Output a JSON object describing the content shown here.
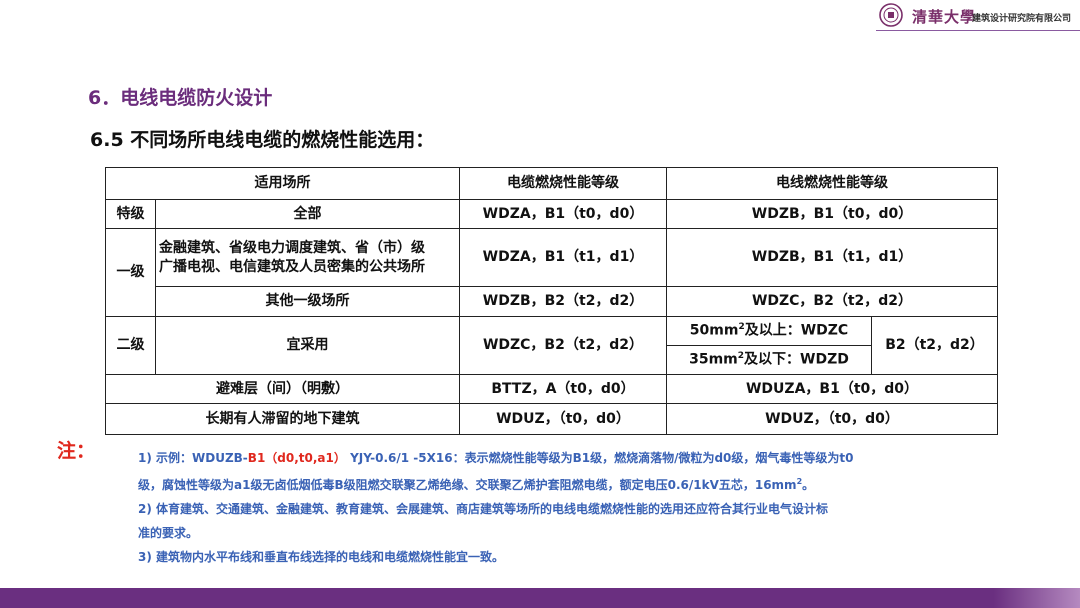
{
  "header": {
    "brand": "清華大學",
    "org": "建筑设计研究院有限公司"
  },
  "section_title": "6．电线电缆防火设计",
  "subtitle": "6.5 不同场所电线电缆的燃烧性能选用：",
  "table": {
    "headers": [
      "适用场所",
      "电缆燃烧性能等级",
      "电线燃烧性能等级"
    ],
    "special": {
      "grade": "特级",
      "place": "全部",
      "cable": "WDZA，B1（t0，d0）",
      "wire": "WDZB，B1（t0，d0）"
    },
    "level1": {
      "grade": "一级",
      "place_line1": "金融建筑、省级电力调度建筑、省（市）级",
      "place_line2": "广播电视、电信建筑及人员密集的公共场所",
      "cable": "WDZA，B1（t1，d1）",
      "wire": "WDZB，B1（t1，d1）",
      "other_place": "其他一级场所",
      "other_cable": "WDZB，B2（t2，d2）",
      "other_wire": "WDZC，B2（t2，d2）"
    },
    "level2": {
      "grade": "二级",
      "place": "宜采用",
      "cable": "WDZC，B2（t2，d2）",
      "wire_large_pre": "50mm",
      "wire_large_post": "及以上：WDZC",
      "wire_small_pre": "35mm",
      "wire_small_post": "及以下：WDZD",
      "wire_sup": "2",
      "wire_grade": "B2（t2，d2）"
    },
    "refuge": {
      "place": "避难层（间）（明敷）",
      "cable": "BTTZ，A（t0，d0）",
      "wire": "WDUZA，B1（t0，d0）"
    },
    "basement": {
      "place": "长期有人滞留的地下建筑",
      "cable": "WDUZ，（t0，d0）",
      "wire": "WDUZ，（t0，d0）"
    }
  },
  "notes": {
    "label": "注：",
    "n1_prefix": "1) 示例：WDUZB-",
    "n1_highlight": "B1（d0,t0,a1）",
    "n1_line1": " YJY-0.6/1 -5X16：表示燃烧性能等级为B1级，燃烧滴落物/微粒为d0级，烟气毒性等级为t0",
    "n1_line2_pre": "级，腐蚀性等级为a1级无卤低烟低毒B级阻燃交联聚乙烯绝缘、交联聚乙烯护套阻燃电缆，额定电压0.6/1kV五芯，16mm",
    "n1_sup": "2",
    "n1_line2_post": "。",
    "n2_line1": "2) 体育建筑、交通建筑、金融建筑、教育建筑、会展建筑、商店建筑等场所的电线电缆燃烧性能的选用还应符合其行业电气设计标",
    "n2_line2": "准的要求。",
    "n3": "3) 建筑物内水平布线和垂直布线选择的电线和电缆燃烧性能宜一致。"
  },
  "colors": {
    "accent_purple": "#6b2d7c",
    "note_red": "#e0281e",
    "note_blue": "#3a62b5"
  }
}
